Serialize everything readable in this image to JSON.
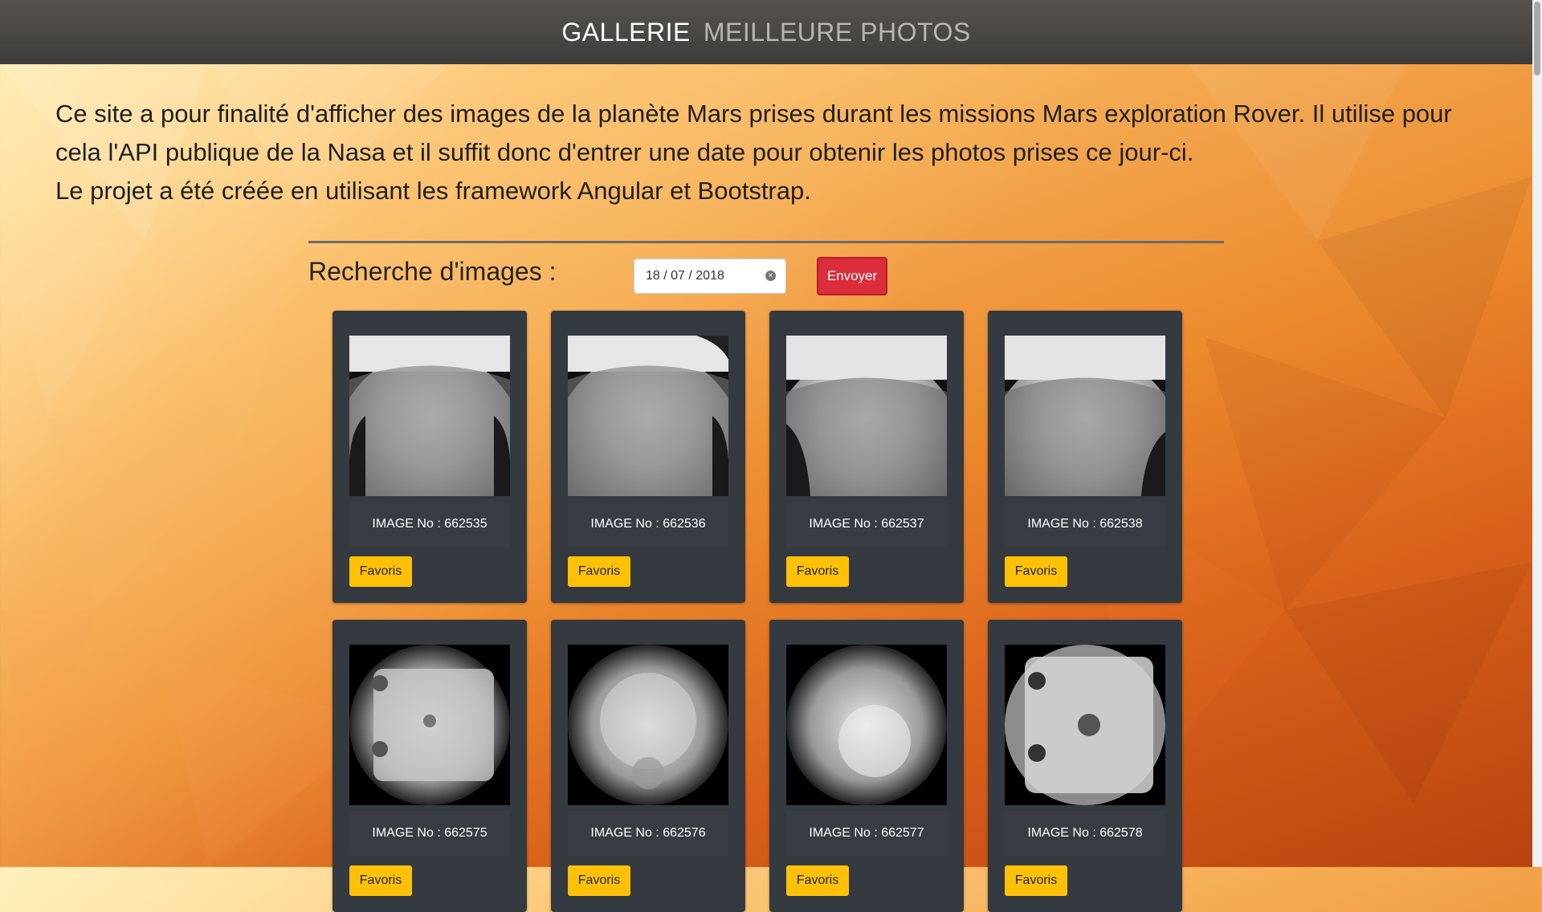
{
  "navbar": {
    "active_link": "GALLERIE",
    "other_link": "MEILLEURE PHOTOS"
  },
  "intro": {
    "line1": "Ce site a pour finalité d'afficher des images de la planète Mars prises durant les missions Mars exploration Rover. Il utilise pour cela l'API publique de la Nasa et il suffit donc d'entrer une date pour obtenir les photos prises ce jour-ci.",
    "line2": "Le projet a été créée en utilisant les framework Angular et Bootstrap."
  },
  "search": {
    "label": "Recherche d'images :",
    "date_value": "18 / 07 / 2018",
    "submit_label": "Envoyer"
  },
  "colors": {
    "navbar": "#48 4644",
    "send_button": "#dc2d3a",
    "favorite_button": "#ffc107",
    "card": "#343a40"
  },
  "gallery": {
    "cards": [
      {
        "caption": "IMAGE No : 662535",
        "button": "Favoris",
        "photo": "mars-horizon-rocky"
      },
      {
        "caption": "IMAGE No : 662536",
        "button": "Favoris",
        "photo": "mars-horizon-rocky"
      },
      {
        "caption": "IMAGE No : 662537",
        "button": "Favoris",
        "photo": "mars-horizon-flat"
      },
      {
        "caption": "IMAGE No : 662538",
        "button": "Favoris",
        "photo": "mars-horizon-flat"
      },
      {
        "caption": "IMAGE No : 662575",
        "button": "Favoris",
        "photo": "lens-closeup-plate"
      },
      {
        "caption": "IMAGE No : 662576",
        "button": "Favoris",
        "photo": "lens-closeup-ground"
      },
      {
        "caption": "IMAGE No : 662577",
        "button": "Favoris",
        "photo": "lens-closeup-ground"
      },
      {
        "caption": "IMAGE No : 662578",
        "button": "Favoris",
        "photo": "lens-closeup-plate-dark"
      }
    ]
  }
}
